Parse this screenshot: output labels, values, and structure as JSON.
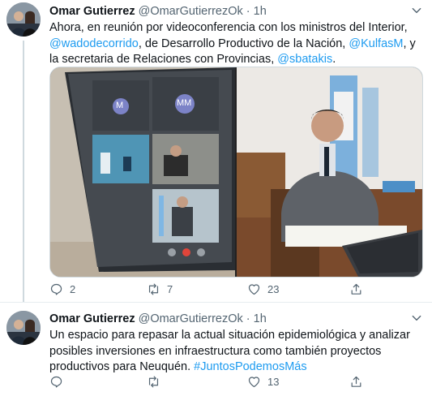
{
  "tweets": [
    {
      "name": "Omar Gutierrez",
      "handle": "@OmarGutierrezOk",
      "dot": "·",
      "time": "1h",
      "text_parts": {
        "t1": "Ahora, en reunión por videoconferencia con los ministros del Interior, ",
        "m1": "@wadodecorrido",
        "t2": ", de Desarrollo Productivo de la Nación, ",
        "m2": "@KulfasM",
        "t3": ", y la secretaria de Relaciones con Provincias, ",
        "m3": "@sbatakis",
        "t4": "."
      },
      "media": {
        "left_video_tiles": [
          "M",
          "MM"
        ]
      },
      "replies": "2",
      "retweets": "7",
      "likes": "23"
    },
    {
      "name": "Omar Gutierrez",
      "handle": "@OmarGutierrezOk",
      "dot": "·",
      "time": "1h",
      "text_parts": {
        "t1": "Un espacio para repasar la actual situación epidemiológica y analizar posibles inversiones en infraestructura como también proyectos productivos para Neuquén. ",
        "h1": "#JuntosPodemosMás"
      },
      "replies": "",
      "retweets": "",
      "likes": "13"
    }
  ],
  "icons": {
    "caret": "chevron-down-icon",
    "reply": "reply-icon",
    "retweet": "retweet-icon",
    "like": "heart-icon",
    "share": "share-icon"
  },
  "colors": {
    "link": "#1d9bf0",
    "secondary": "#536471",
    "divider": "#e6ecf0"
  }
}
